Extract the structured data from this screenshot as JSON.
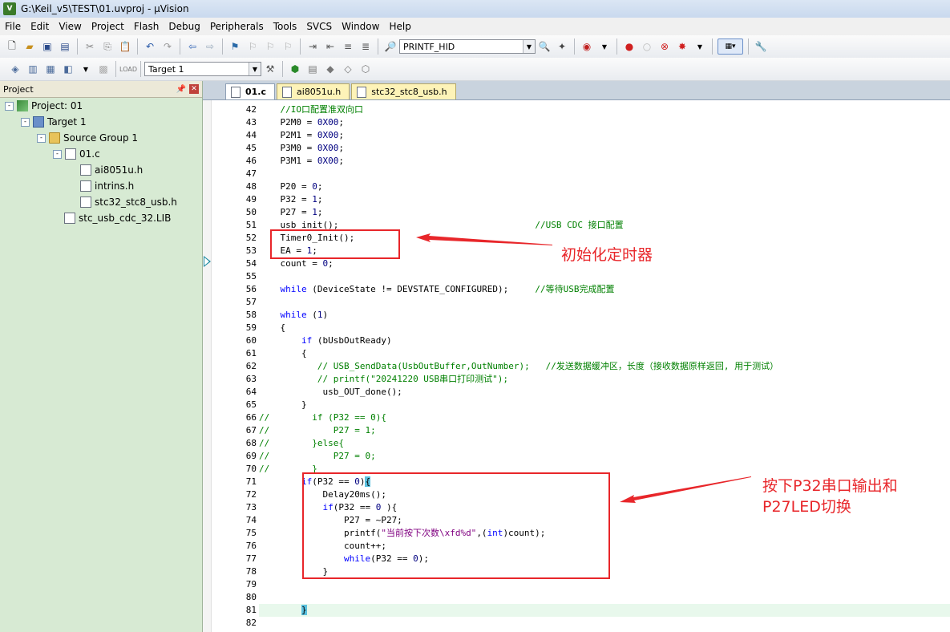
{
  "window": {
    "title": "G:\\Keil_v5\\TEST\\01.uvproj - µVision"
  },
  "menu": [
    "File",
    "Edit",
    "View",
    "Project",
    "Flash",
    "Debug",
    "Peripherals",
    "Tools",
    "SVCS",
    "Window",
    "Help"
  ],
  "toolbar": {
    "find_combo": "PRINTF_HID",
    "target_combo": "Target 1"
  },
  "project_panel": {
    "title": "Project",
    "tree": [
      {
        "label": "Project: 01",
        "level": 0,
        "icon": "project-icon",
        "expander": "-"
      },
      {
        "label": "Target 1",
        "level": 1,
        "icon": "target-icon",
        "expander": "-"
      },
      {
        "label": "Source Group 1",
        "level": 2,
        "icon": "folder-icon",
        "expander": "-"
      },
      {
        "label": "01.c",
        "level": 3,
        "icon": "file-icon",
        "expander": "-"
      },
      {
        "label": "ai8051u.h",
        "level": 4,
        "icon": "file-icon",
        "expander": ""
      },
      {
        "label": "intrins.h",
        "level": 4,
        "icon": "file-icon",
        "expander": ""
      },
      {
        "label": "stc32_stc8_usb.h",
        "level": 4,
        "icon": "file-icon",
        "expander": ""
      },
      {
        "label": "stc_usb_cdc_32.LIB",
        "level": 3,
        "icon": "file-icon",
        "expander": ""
      }
    ]
  },
  "tabs": [
    {
      "label": "01.c",
      "active": true
    },
    {
      "label": "ai8051u.h",
      "active": false
    },
    {
      "label": "stc32_stc8_usb.h",
      "active": false
    }
  ],
  "code_lines": [
    {
      "n": "42",
      "html": "    <span class=\"cm\">//IO口配置准双向口</span>"
    },
    {
      "n": "43",
      "html": "    P2M0 = <span class=\"num\">0X00</span>;"
    },
    {
      "n": "44",
      "html": "    P2M1 = <span class=\"num\">0X00</span>;"
    },
    {
      "n": "45",
      "html": "    P3M0 = <span class=\"num\">0X00</span>;"
    },
    {
      "n": "46",
      "html": "    P3M1 = <span class=\"num\">0X00</span>;"
    },
    {
      "n": "47",
      "html": ""
    },
    {
      "n": "48",
      "html": "    P20 = <span class=\"num\">0</span>;"
    },
    {
      "n": "49",
      "html": "    P32 = <span class=\"num\">1</span>;"
    },
    {
      "n": "50",
      "html": "    P27 = <span class=\"num\">1</span>;"
    },
    {
      "n": "51",
      "html": "    usb_init();                                     <span class=\"cm\">//USB CDC 接口配置</span>"
    },
    {
      "n": "52",
      "html": "    Timer0_Init();"
    },
    {
      "n": "53",
      "html": "    EA = <span class=\"num\">1</span>;"
    },
    {
      "n": "54",
      "html": "    count = <span class=\"num\">0</span>;"
    },
    {
      "n": "55",
      "html": ""
    },
    {
      "n": "56",
      "html": "    <span class=\"kw\">while</span> (DeviceState != DEVSTATE_CONFIGURED);     <span class=\"cm\">//等待USB完成配置</span>"
    },
    {
      "n": "57",
      "html": ""
    },
    {
      "n": "58",
      "html": "    <span class=\"kw\">while</span> (<span class=\"num\">1</span>)"
    },
    {
      "n": "59",
      "html": "    {"
    },
    {
      "n": "60",
      "html": "        <span class=\"kw\">if</span> (bUsbOutReady)"
    },
    {
      "n": "61",
      "html": "        {"
    },
    {
      "n": "62",
      "html": "           <span class=\"cm\">// USB_SendData(UsbOutBuffer,OutNumber);   //发送数据缓冲区，长度（接收数据原样返回, 用于测试）</span>"
    },
    {
      "n": "63",
      "html": "           <span class=\"cm\">// printf(\"20241220 USB串口打印测试\");</span>"
    },
    {
      "n": "64",
      "html": "            usb_OUT_done();"
    },
    {
      "n": "65",
      "html": "        }"
    },
    {
      "n": "66",
      "html": "<span class=\"cm\">//        if (P32 == 0){</span>"
    },
    {
      "n": "67",
      "html": "<span class=\"cm\">//            P27 = 1;</span>"
    },
    {
      "n": "68",
      "html": "<span class=\"cm\">//        }else{</span>"
    },
    {
      "n": "69",
      "html": "<span class=\"cm\">//            P27 = 0;</span>"
    },
    {
      "n": "70",
      "html": "<span class=\"cm\">//        }</span>"
    },
    {
      "n": "71",
      "html": "        <span class=\"kw\">if</span>(P32 == <span class=\"num\">0</span>)<span class=\"cursor\">{</span>"
    },
    {
      "n": "72",
      "html": "            Delay20ms();"
    },
    {
      "n": "73",
      "html": "            <span class=\"kw\">if</span>(P32 == <span class=\"num\">0</span> ){"
    },
    {
      "n": "74",
      "html": "                P27 = ~P27;"
    },
    {
      "n": "75",
      "html": "                printf(<span class=\"str\">\"当前按下次数\\xfd%d\"</span>,(<span class=\"kw\">int</span>)count);"
    },
    {
      "n": "76",
      "html": "                count++;"
    },
    {
      "n": "77",
      "html": "                <span class=\"kw\">while</span>(P32 == <span class=\"num\">0</span>);"
    },
    {
      "n": "78",
      "html": "            }"
    },
    {
      "n": "79",
      "html": ""
    },
    {
      "n": "80",
      "html": ""
    },
    {
      "n": "81",
      "html": "        <span class=\"cursor\">}</span>"
    },
    {
      "n": "82",
      "html": ""
    }
  ],
  "annotations": {
    "timer_note": "初始化定时器",
    "button_note_line1": "按下P32串口输出和",
    "button_note_line2": "P27LED切换"
  },
  "colors": {
    "annotation_red": "#e8262a",
    "project_panel_bg": "#d7ead3",
    "keyword_blue": "#0000ff",
    "comment_green": "#008000"
  }
}
